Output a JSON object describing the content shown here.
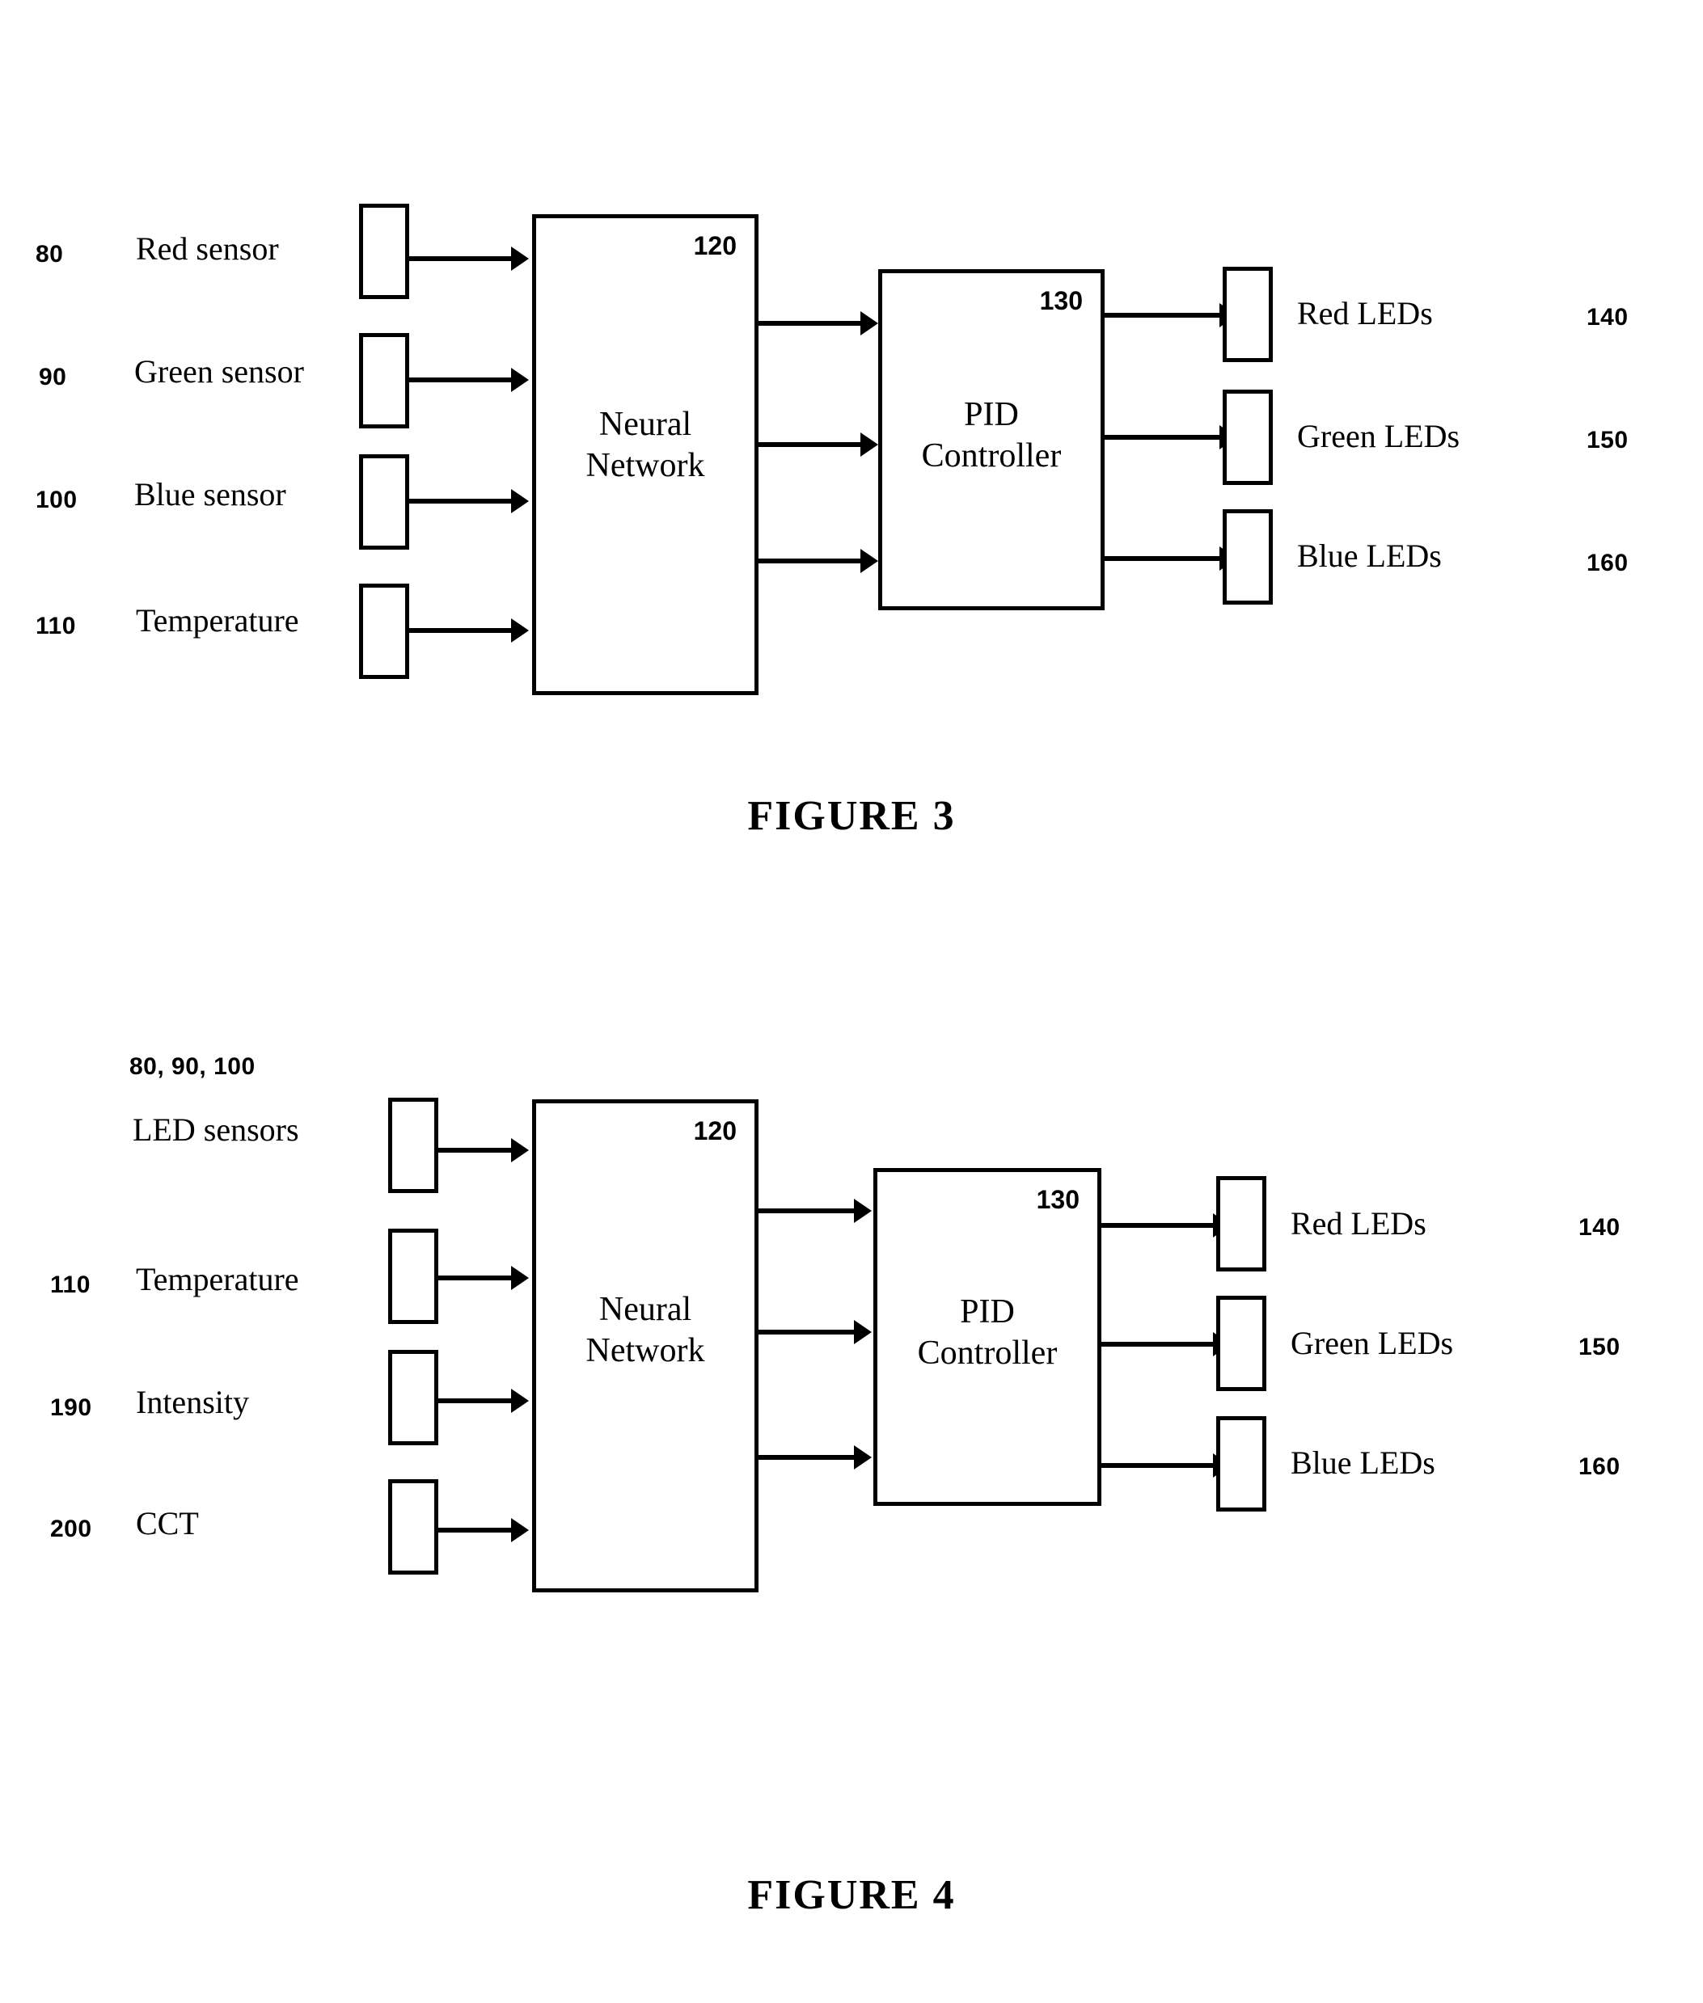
{
  "document": {
    "type": "patent-drawing-sheet",
    "background_color": "#ffffff",
    "line_color": "#000000"
  },
  "figures": [
    {
      "id": "figure-3",
      "caption": "FIGURE 3",
      "inputs": [
        {
          "ref": "80",
          "label": "Red sensor"
        },
        {
          "ref": "90",
          "label": "Green sensor"
        },
        {
          "ref": "100",
          "label": "Blue sensor"
        },
        {
          "ref": "110",
          "label": "Temperature"
        }
      ],
      "blocks": [
        {
          "ref": "120",
          "title_line1": "Neural",
          "title_line2": "Network"
        },
        {
          "ref": "130",
          "title_line1": "PID",
          "title_line2": "Controller"
        }
      ],
      "outputs": [
        {
          "ref": "140",
          "label": "Red LEDs"
        },
        {
          "ref": "150",
          "label": "Green LEDs"
        },
        {
          "ref": "160",
          "label": "Blue LEDs"
        }
      ]
    },
    {
      "id": "figure-4",
      "caption": "FIGURE 4",
      "inputs": [
        {
          "ref": "80, 90, 100",
          "label": "LED sensors"
        },
        {
          "ref": "110",
          "label": "Temperature"
        },
        {
          "ref": "190",
          "label": "Intensity"
        },
        {
          "ref": "200",
          "label": "CCT"
        }
      ],
      "blocks": [
        {
          "ref": "120",
          "title_line1": "Neural",
          "title_line2": "Network"
        },
        {
          "ref": "130",
          "title_line1": "PID",
          "title_line2": "Controller"
        }
      ],
      "outputs": [
        {
          "ref": "140",
          "label": "Red LEDs"
        },
        {
          "ref": "150",
          "label": "Green LEDs"
        },
        {
          "ref": "160",
          "label": "Blue LEDs"
        }
      ]
    }
  ]
}
